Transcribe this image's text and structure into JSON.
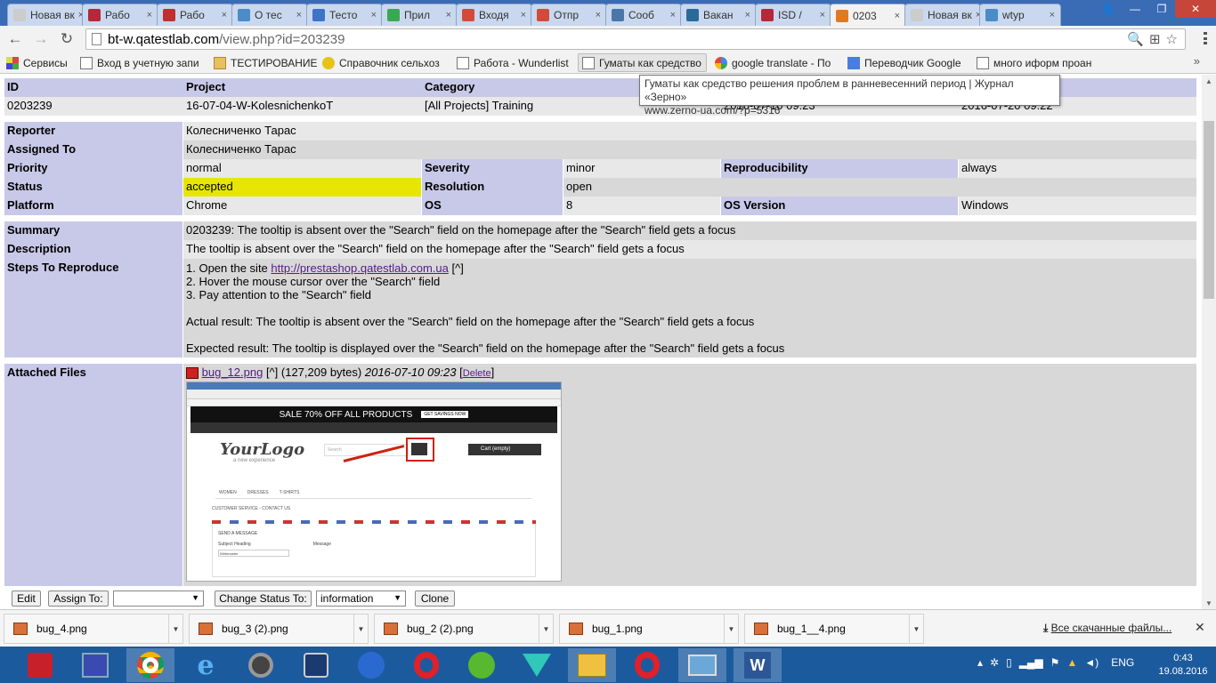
{
  "browser": {
    "tabs": [
      {
        "label": "Новая вк",
        "color": "#cccccc"
      },
      {
        "label": "Рабо",
        "color": "#b5283a"
      },
      {
        "label": "Рабо",
        "color": "#c03030"
      },
      {
        "label": "О тес",
        "color": "#4a8cc8"
      },
      {
        "label": "Тесто",
        "color": "#3d74c8"
      },
      {
        "label": "Прил",
        "color": "#3aa852"
      },
      {
        "label": "Входя",
        "color": "#d44a3a"
      },
      {
        "label": "Отпр",
        "color": "#d44a3a"
      },
      {
        "label": "Сооб",
        "color": "#4a76a8"
      },
      {
        "label": "Вакан",
        "color": "#2a6a9a"
      },
      {
        "label": "ISD /",
        "color": "#b5283a"
      },
      {
        "label": "0203",
        "color": "#e07a20"
      },
      {
        "label": "Новая вк",
        "color": "#cccccc"
      },
      {
        "label": "wtyp",
        "color": "#4a8cc8"
      }
    ],
    "url_host": "bt-w.qatestlab.com",
    "url_path": "/view.php?id=203239",
    "bookmarks": [
      {
        "label": "Сервисы"
      },
      {
        "label": "Вход в учетную запи"
      },
      {
        "label": "ТЕСТИРОВАНИЕ"
      },
      {
        "label": "Справочник сельхоз"
      },
      {
        "label": "Работа - Wunderlist"
      },
      {
        "label": "Гуматы как средство"
      },
      {
        "label": "google translate - По"
      },
      {
        "label": "Переводчик Google"
      },
      {
        "label": "много иформ проан"
      }
    ],
    "bookmarks_more": "»"
  },
  "tooltip": {
    "line1": "Гуматы как средство решения проблем в ранневесенний период | Журнал «Зерно»",
    "line2": "www.zerno-ua.com/?p=5316"
  },
  "issue": {
    "header": {
      "id_label": "ID",
      "project_label": "Project",
      "category_label": "Category",
      "id": "0203239",
      "project": "16-07-04-W-KolesnichenkoT",
      "category": "[All Projects] Training",
      "date_submitted": "2016-07-10 09:23",
      "last_update": "2016-07-20 09:22"
    },
    "reporter_label": "Reporter",
    "reporter": "Колесниченко Тарас",
    "assigned_label": "Assigned To",
    "assigned": "Колесниченко Тарас",
    "priority_label": "Priority",
    "priority": "normal",
    "severity_label": "Severity",
    "severity": "minor",
    "reproducibility_label": "Reproducibility",
    "reproducibility": "always",
    "status_label": "Status",
    "status": "accepted",
    "resolution_label": "Resolution",
    "resolution": "open",
    "platform_label": "Platform",
    "platform": "Chrome",
    "os_label": "OS",
    "os": "8",
    "os_version_label": "OS Version",
    "os_version": "Windows",
    "summary_label": "Summary",
    "summary": "0203239: The tooltip is absent over the \"Search\" field on the homepage after the \"Search\" field gets a focus",
    "description_label": "Description",
    "description": "The tooltip is absent over the \"Search\" field on the homepage after the \"Search\" field gets a focus",
    "steps_label": "Steps To Reproduce",
    "step1_prefix": "1. Open the site",
    "step1_link": "http://prestashop.qatestlab.com.ua",
    "step1_suffix": "[^]",
    "step2": "2. Hover the mouse cursor over the \"Search\" field",
    "step3": "3. Pay attention to the \"Search\" field",
    "actual": "Actual result: The tooltip is absent over the \"Search\" field on the homepage after the \"Search\" field gets a focus",
    "expected": "Expected result: The tooltip is displayed over the \"Search\" field on the homepage after the \"Search\" field gets a focus",
    "attached_label": "Attached Files",
    "file_name": "bug_12.png",
    "file_link_caret": "[^]",
    "file_size": "(127,209 bytes)",
    "file_date": "2016-07-10 09:23",
    "file_delete": "Delete"
  },
  "preview": {
    "banner": "SALE 70% OFF ALL PRODUCTS",
    "banner_btn": "GET SAVINGS NOW",
    "logo": "YourLogo",
    "logo_sub": "a new experience",
    "search_placeholder": "Search",
    "cart": "Cart (empty)",
    "nav": [
      "WOMEN",
      "DRESSES",
      "T-SHIRTS"
    ],
    "breadcrumb": "CUSTOMER SERVICE - CONTACT US",
    "form_title": "SEND A MESSAGE",
    "subject_label": "Subject Heading",
    "subject_value": "Webmaster",
    "message_label": "Message"
  },
  "actions": {
    "edit": "Edit",
    "assign_to": "Assign To:",
    "assign_value": "",
    "change_status": "Change Status To:",
    "status_value": "information",
    "clone": "Clone"
  },
  "downloads": {
    "items": [
      {
        "name": "bug_4.png"
      },
      {
        "name": "bug_3 (2).png"
      },
      {
        "name": "bug_2 (2).png"
      },
      {
        "name": "bug_1.png"
      },
      {
        "name": "bug_1__4.png"
      }
    ],
    "all_label": "Все скачанные файлы...",
    "close": "✕"
  },
  "taskbar": {
    "language": "ENG",
    "time": "0:43",
    "date": "19.08.2016"
  }
}
